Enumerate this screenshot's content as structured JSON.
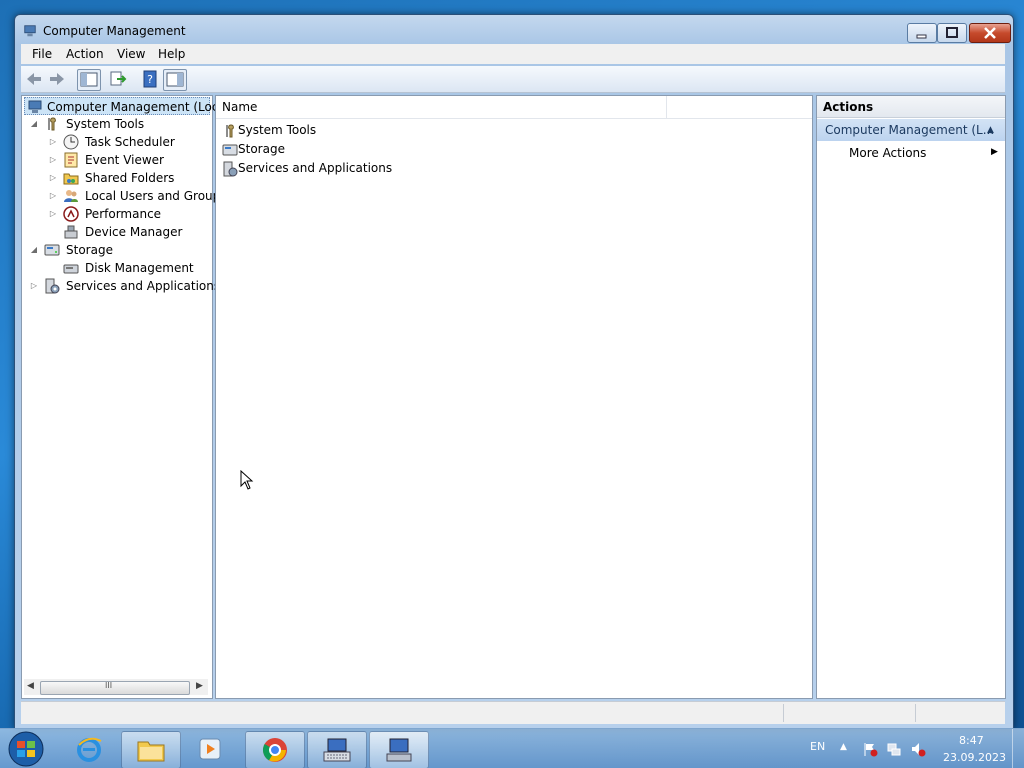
{
  "window": {
    "title": "Computer Management"
  },
  "menu": [
    "File",
    "Action",
    "View",
    "Help"
  ],
  "toolbar": {
    "buttons": [
      "back-arrow-icon",
      "forward-arrow-icon",
      "console-tree-icon",
      "export-list-icon",
      "help-icon",
      "action-pane-icon"
    ]
  },
  "tree": {
    "root": "Computer Management (Local",
    "items": [
      {
        "label": "System Tools",
        "icon": "tools-icon"
      },
      {
        "label": "Task Scheduler",
        "icon": "clock-icon"
      },
      {
        "label": "Event Viewer",
        "icon": "event-viewer-icon"
      },
      {
        "label": "Shared Folders",
        "icon": "shared-folder-icon"
      },
      {
        "label": "Local Users and Groups",
        "icon": "users-icon"
      },
      {
        "label": "Performance",
        "icon": "performance-icon"
      },
      {
        "label": "Device Manager",
        "icon": "device-manager-icon"
      },
      {
        "label": "Storage",
        "icon": "storage-icon"
      },
      {
        "label": "Disk Management",
        "icon": "disk-icon"
      },
      {
        "label": "Services and Applications",
        "icon": "services-icon"
      }
    ],
    "scroll_glyph": "III"
  },
  "center": {
    "column": "Name",
    "rows": [
      "System Tools",
      "Storage",
      "Services and Applications"
    ]
  },
  "actions": {
    "header": "Actions",
    "section": "Computer Management (L...",
    "item": "More Actions"
  },
  "taskbar": {
    "language": "EN",
    "time": "8:47",
    "date": "23.09.2023",
    "apps": [
      "internet-explorer-icon",
      "explorer-icon",
      "media-player-icon",
      "chrome-icon",
      "keyboard-icon",
      "computer-management-icon"
    ]
  },
  "colors": {
    "accent": "#3399ff",
    "selection": "#cce4f7"
  }
}
